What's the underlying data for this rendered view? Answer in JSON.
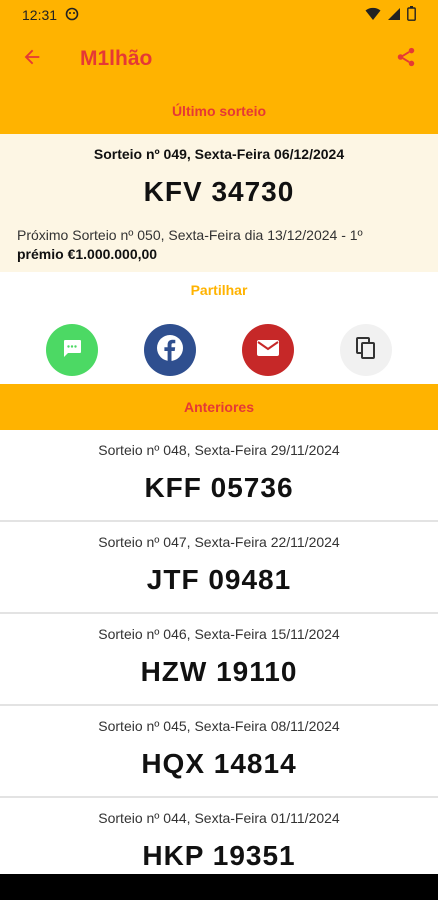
{
  "status": {
    "time": "12:31"
  },
  "app": {
    "title": "M1lhão"
  },
  "headers": {
    "latest": "Último sorteio",
    "share": "Partilhar",
    "previous": "Anteriores"
  },
  "latest": {
    "date": "Sorteio nº 049, Sexta-Feira 06/12/2024",
    "code": "KFV 34730",
    "next_prefix": "Próximo Sorteio nº 050, Sexta-Feira dia 13/12/2024 - 1º",
    "next_prize": "prémio €1.000.000,00"
  },
  "draws": [
    {
      "date": "Sorteio nº 048, Sexta-Feira 29/11/2024",
      "code": "KFF 05736"
    },
    {
      "date": "Sorteio nº 047, Sexta-Feira 22/11/2024",
      "code": "JTF 09481"
    },
    {
      "date": "Sorteio nº 046, Sexta-Feira 15/11/2024",
      "code": "HZW 19110"
    },
    {
      "date": "Sorteio nº 045, Sexta-Feira 08/11/2024",
      "code": "HQX 14814"
    },
    {
      "date": "Sorteio nº 044, Sexta-Feira 01/11/2024",
      "code": "HKP 19351"
    }
  ],
  "colors": {
    "accent": "#ffb300",
    "brand_red": "#e53935",
    "latest_bg": "#fdf6e4"
  },
  "icons": [
    "arrow-back-icon",
    "share-icon",
    "sms-icon",
    "facebook-icon",
    "mail-icon",
    "copy-icon"
  ]
}
